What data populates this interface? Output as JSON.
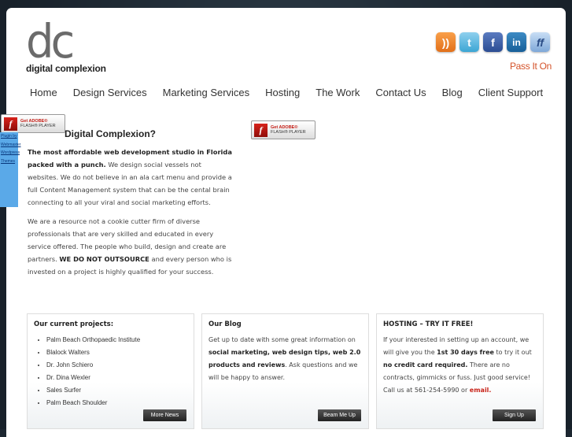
{
  "brand": {
    "mark": "dc",
    "name": "digital complexion"
  },
  "social": [
    {
      "icon": "rss-icon",
      "glyph": "))"
    },
    {
      "icon": "twitter-icon",
      "glyph": "t"
    },
    {
      "icon": "facebook-icon",
      "glyph": "f"
    },
    {
      "icon": "linkedin-icon",
      "glyph": "in"
    },
    {
      "icon": "friendfeed-icon",
      "glyph": "ff"
    }
  ],
  "pass_it_on": "Pass It On",
  "nav": [
    "Home",
    "Design Services",
    "Marketing Services",
    "Hosting",
    "The Work",
    "Contact Us",
    "Blog",
    "Client Support"
  ],
  "flash": {
    "line1": "Get ADOBE®",
    "line2": "FLASH® PLAYER"
  },
  "side_links": [
    "Plugin by",
    "Webmaster",
    "Wordpress",
    "Themes"
  ],
  "headline": "Digital Complexion?",
  "intro": {
    "p1_bold": "The most affordable web development studio in Florida packed with a punch.",
    "p1_rest": " We design social vessels not websites. We do not believe in an ala cart menu and provide a full Content Management system that can be the cental brain connecting to all your viral and social marketing efforts.",
    "p2_start": "We are a resource not a cookie cutter firm of diverse professionals that are very skilled and educated in every service offered. The people who build, design and create are partners. ",
    "p2_bold": "WE DO NOT OUTSOURCE",
    "p2_end": " and every person who is invested on a project is highly qualified for your success."
  },
  "projects": {
    "title": "Our current projects:",
    "items": [
      "Palm Beach Orthopaedic Institute",
      "Blalock Walters",
      "Dr. John Schiero",
      "Dr. Dina Wexler",
      "Sales Surfer",
      "Palm Beach Shoulder"
    ],
    "button": "More News"
  },
  "blog": {
    "title": "Our Blog",
    "t1": "Get up to date with some great information on ",
    "b1": "social marketing, web design tips, web 2.0 products and reviews",
    "t2": ". Ask questions and we will be happy to answer.",
    "button": "Beam Me Up"
  },
  "hosting": {
    "title": "HOSTING – TRY IT FREE!",
    "t1": "If your interested in setting up an account, we will give you the ",
    "b1": "1st 30 days free",
    "t2": " to try it out ",
    "b2": "no credit card required.",
    "t3": " There are no contracts, gimmicks or fuss. Just good service! Call us at 561-254-5990 or ",
    "email": "email.",
    "button": "Sign Up"
  }
}
